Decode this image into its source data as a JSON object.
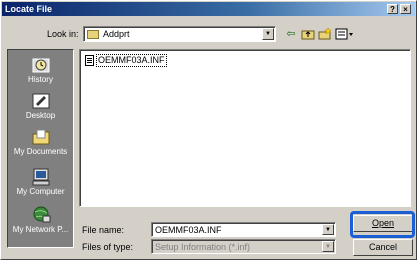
{
  "window": {
    "title": "Locate File",
    "help_label": "?",
    "close_label": "×"
  },
  "look_in": {
    "label": "Look in:",
    "value": "Addprt"
  },
  "toolbar": {
    "back_icon": "back-arrow-icon",
    "up_icon": "up-folder-icon",
    "new_folder_icon": "new-folder-icon",
    "views_icon": "views-menu-icon"
  },
  "places": [
    {
      "label": "History",
      "icon": "history-icon"
    },
    {
      "label": "Desktop",
      "icon": "desktop-icon"
    },
    {
      "label": "My Documents",
      "icon": "my-documents-icon"
    },
    {
      "label": "My Computer",
      "icon": "my-computer-icon"
    },
    {
      "label": "My Network P...",
      "icon": "my-network-icon"
    }
  ],
  "files": [
    {
      "name": "OEMMF03A.INF",
      "icon": "inf-file-icon"
    }
  ],
  "file_name": {
    "label": "File name:",
    "value": "OEMMF03A.INF"
  },
  "file_type": {
    "label": "Files of type:",
    "value": "Setup Information (*.inf)"
  },
  "buttons": {
    "open": "Open",
    "cancel": "Cancel"
  },
  "colors": {
    "highlight": "#1a5fd6",
    "title_bar": "#0a246a",
    "dialog_bg": "#d4d0c8"
  }
}
